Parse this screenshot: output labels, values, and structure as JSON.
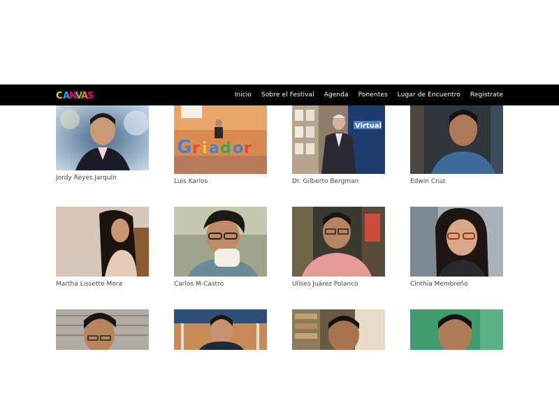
{
  "site": {
    "logo_text": "CANVAS",
    "logo_colors": [
      "#ffd500",
      "#00b4e6",
      "#e8007d",
      "#7ac143",
      "#f47b20",
      "#8e44ad"
    ]
  },
  "nav": {
    "items": [
      "Inicio",
      "Sobre el Festival",
      "Agenda",
      "Ponentes",
      "Lugar de Encuentro",
      "Registrate"
    ]
  },
  "speakers": [
    {
      "name": "Jordy Reyes Jarquín"
    },
    {
      "name": "Luis Karlos"
    },
    {
      "name": "Dr. Gilberto Bergman"
    },
    {
      "name": "Edwin Cruz"
    },
    {
      "name": "Martha Lissette Mora"
    },
    {
      "name": "Carlos M-Castro"
    },
    {
      "name": "Ulises Juárez Polanco"
    },
    {
      "name": "Cinthia Membreño"
    },
    {
      "name": ""
    },
    {
      "name": ""
    },
    {
      "name": ""
    },
    {
      "name": ""
    }
  ]
}
